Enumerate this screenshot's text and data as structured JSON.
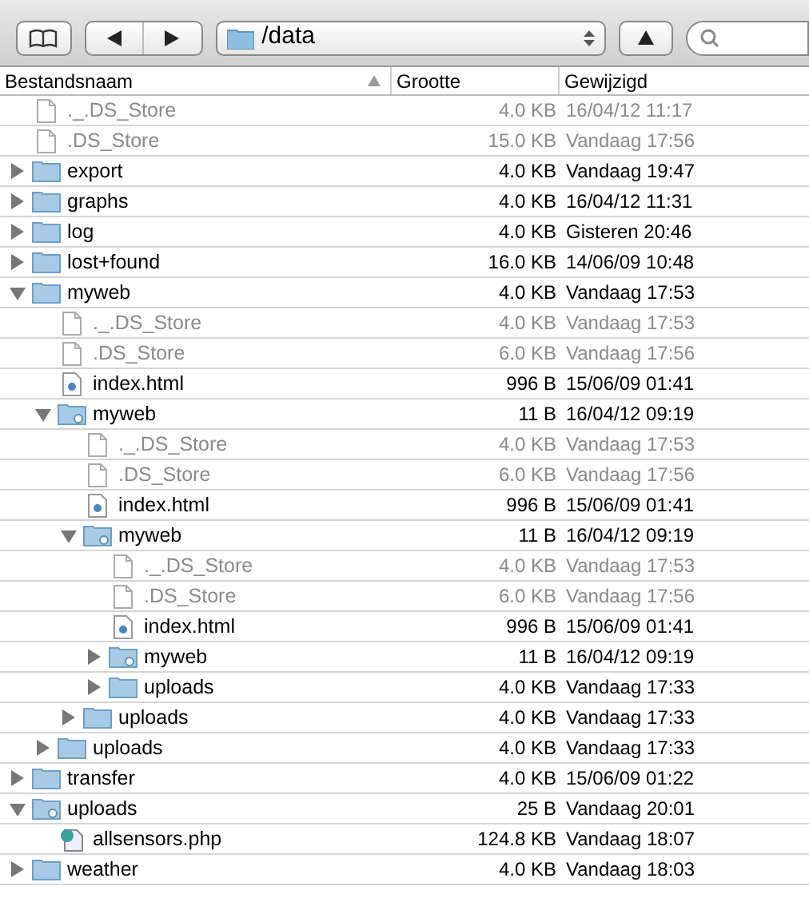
{
  "toolbar": {
    "path": "/data"
  },
  "columns": [
    "Bestandsnaam",
    "Grootte",
    "Gewijzigd"
  ],
  "items": [
    {
      "name": "._.DS_Store",
      "kind": "file",
      "dimmed": true,
      "size": "4.0 KB",
      "modified": "16/04/12 11:17"
    },
    {
      "name": ".DS_Store",
      "kind": "file",
      "dimmed": true,
      "size": "15.0 KB",
      "modified": "Vandaag 17:56"
    },
    {
      "name": "export",
      "kind": "folder",
      "dimmed": false,
      "expanded": false,
      "size": "4.0 KB",
      "modified": "Vandaag 19:47"
    },
    {
      "name": "graphs",
      "kind": "folder",
      "dimmed": false,
      "expanded": false,
      "size": "4.0 KB",
      "modified": "16/04/12 11:31"
    },
    {
      "name": "log",
      "kind": "folder",
      "dimmed": false,
      "expanded": false,
      "size": "4.0 KB",
      "modified": "Gisteren 20:46"
    },
    {
      "name": "lost+found",
      "kind": "folder",
      "dimmed": false,
      "expanded": false,
      "size": "16.0 KB",
      "modified": "14/06/09 10:48"
    },
    {
      "name": "myweb",
      "kind": "folder",
      "dimmed": false,
      "expanded": true,
      "size": "4.0 KB",
      "modified": "Vandaag 17:53",
      "children": [
        {
          "name": "._.DS_Store",
          "kind": "file",
          "dimmed": true,
          "size": "4.0 KB",
          "modified": "Vandaag 17:53"
        },
        {
          "name": ".DS_Store",
          "kind": "file",
          "dimmed": true,
          "size": "6.0 KB",
          "modified": "Vandaag 17:56"
        },
        {
          "name": "index.html",
          "kind": "html",
          "dimmed": false,
          "size": "996 B",
          "modified": "15/06/09 01:41"
        },
        {
          "name": "myweb",
          "kind": "alias-folder",
          "dimmed": false,
          "expanded": true,
          "size": "11 B",
          "modified": "16/04/12 09:19",
          "children": [
            {
              "name": "._.DS_Store",
              "kind": "file",
              "dimmed": true,
              "size": "4.0 KB",
              "modified": "Vandaag 17:53"
            },
            {
              "name": ".DS_Store",
              "kind": "file",
              "dimmed": true,
              "size": "6.0 KB",
              "modified": "Vandaag 17:56"
            },
            {
              "name": "index.html",
              "kind": "html",
              "dimmed": false,
              "size": "996 B",
              "modified": "15/06/09 01:41"
            },
            {
              "name": "myweb",
              "kind": "alias-folder",
              "dimmed": false,
              "expanded": true,
              "size": "11 B",
              "modified": "16/04/12 09:19",
              "children": [
                {
                  "name": "._.DS_Store",
                  "kind": "file",
                  "dimmed": true,
                  "size": "4.0 KB",
                  "modified": "Vandaag 17:53"
                },
                {
                  "name": ".DS_Store",
                  "kind": "file",
                  "dimmed": true,
                  "size": "6.0 KB",
                  "modified": "Vandaag 17:56"
                },
                {
                  "name": "index.html",
                  "kind": "html",
                  "dimmed": false,
                  "size": "996 B",
                  "modified": "15/06/09 01:41"
                },
                {
                  "name": "myweb",
                  "kind": "alias-folder",
                  "dimmed": false,
                  "expanded": false,
                  "size": "11 B",
                  "modified": "16/04/12 09:19"
                },
                {
                  "name": "uploads",
                  "kind": "folder",
                  "dimmed": false,
                  "expanded": false,
                  "size": "4.0 KB",
                  "modified": "Vandaag 17:33"
                }
              ]
            },
            {
              "name": "uploads",
              "kind": "folder",
              "dimmed": false,
              "expanded": false,
              "size": "4.0 KB",
              "modified": "Vandaag 17:33"
            }
          ]
        },
        {
          "name": "uploads",
          "kind": "folder",
          "dimmed": false,
          "expanded": false,
          "size": "4.0 KB",
          "modified": "Vandaag 17:33"
        }
      ]
    },
    {
      "name": "transfer",
      "kind": "folder",
      "dimmed": false,
      "expanded": false,
      "size": "4.0 KB",
      "modified": "15/06/09 01:22"
    },
    {
      "name": "uploads",
      "kind": "alias-folder",
      "dimmed": false,
      "expanded": true,
      "size": "25 B",
      "modified": "Vandaag 20:01",
      "children": [
        {
          "name": "allsensors.php",
          "kind": "php",
          "dimmed": false,
          "size": "124.8 KB",
          "modified": "Vandaag 18:07"
        }
      ]
    },
    {
      "name": "weather",
      "kind": "folder",
      "dimmed": false,
      "expanded": false,
      "size": "4.0 KB",
      "modified": "Vandaag 18:03"
    }
  ]
}
